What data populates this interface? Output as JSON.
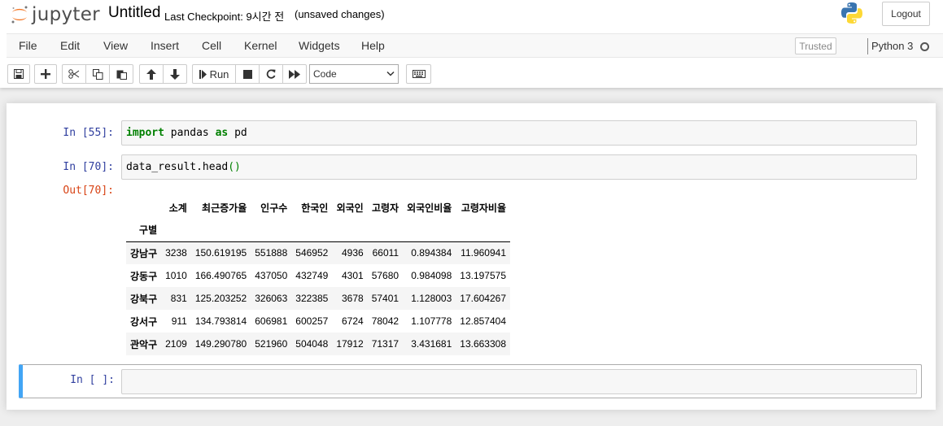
{
  "header": {
    "logo_text": "jupyter",
    "notebook_name": "Untitled",
    "checkpoint": "Last Checkpoint: 9시간 전",
    "unsaved": "(unsaved changes)",
    "logout_label": "Logout"
  },
  "menu": {
    "items": [
      "File",
      "Edit",
      "View",
      "Insert",
      "Cell",
      "Kernel",
      "Widgets",
      "Help"
    ],
    "trusted": "Trusted",
    "kernel": "Python 3"
  },
  "toolbar": {
    "run_label": "Run",
    "cell_type": "Code"
  },
  "cells": [
    {
      "prompt": "In [55]:",
      "code_kw1": "import",
      "code_mid": " pandas ",
      "code_kw2": "as",
      "code_end": " pd"
    },
    {
      "prompt": "In [70]:",
      "code": "data_result.head",
      "code_paren": "()"
    }
  ],
  "output": {
    "prompt": "Out[70]:",
    "columns": [
      "소계",
      "최근증가율",
      "인구수",
      "한국인",
      "외국인",
      "고령자",
      "외국인비율",
      "고령자비율"
    ],
    "index_name": "구별",
    "rows": [
      [
        "강남구",
        "3238",
        "150.619195",
        "551888",
        "546952",
        "4936",
        "66011",
        "0.894384",
        "11.960941"
      ],
      [
        "강동구",
        "1010",
        "166.490765",
        "437050",
        "432749",
        "4301",
        "57680",
        "0.984098",
        "13.197575"
      ],
      [
        "강북구",
        "831",
        "125.203252",
        "326063",
        "322385",
        "3678",
        "57401",
        "1.128003",
        "17.604267"
      ],
      [
        "강서구",
        "911",
        "134.793814",
        "606981",
        "600257",
        "6724",
        "78042",
        "1.107778",
        "12.857404"
      ],
      [
        "관악구",
        "2109",
        "149.290780",
        "521960",
        "504048",
        "17912",
        "71317",
        "3.431681",
        "13.663308"
      ]
    ]
  },
  "empty_cell": {
    "prompt": "In [ ]:"
  },
  "colors": {
    "in_prompt": "#303f9f",
    "out_prompt": "#d84315",
    "selected_cell_border": "#42a5f5",
    "keyword": "#008000"
  }
}
